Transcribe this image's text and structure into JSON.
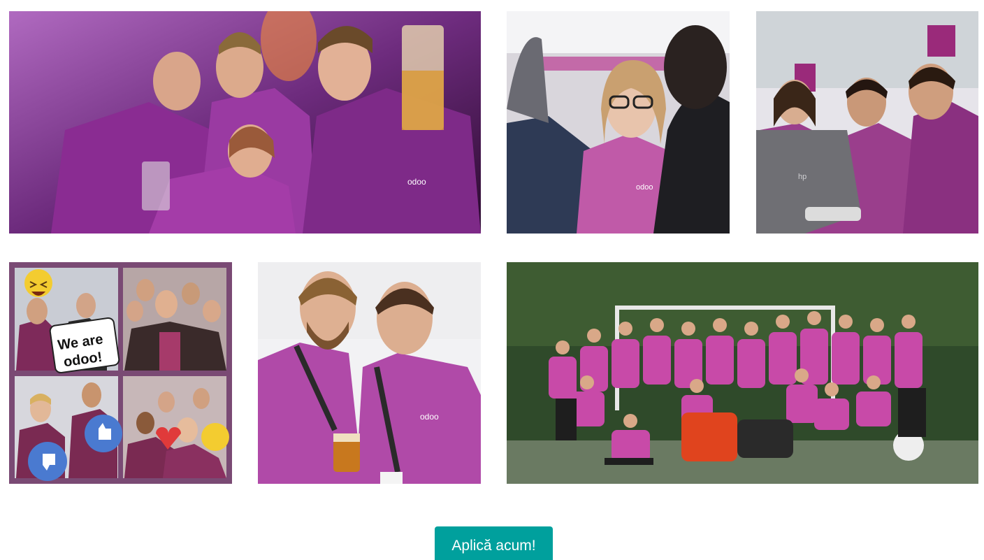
{
  "photos": [
    {
      "name": "party-team-photo",
      "shirt_logo": "odoo"
    },
    {
      "name": "conference-woman-photo",
      "shirt_logo": "odoo"
    },
    {
      "name": "laptop-team-photo",
      "laptop_logo": "hp"
    },
    {
      "name": "photobooth-collage-photo",
      "sign_line1": "We are",
      "sign_line2": "odoo!"
    },
    {
      "name": "two-colleagues-photo",
      "shirt_logo": "odoo"
    },
    {
      "name": "hockey-team-photo"
    }
  ],
  "colors": {
    "brand_purple": "#8e3a8a",
    "button_teal": "#00A09D",
    "button_text": "#ffffff"
  },
  "cta": {
    "label": "Aplică acum!"
  }
}
